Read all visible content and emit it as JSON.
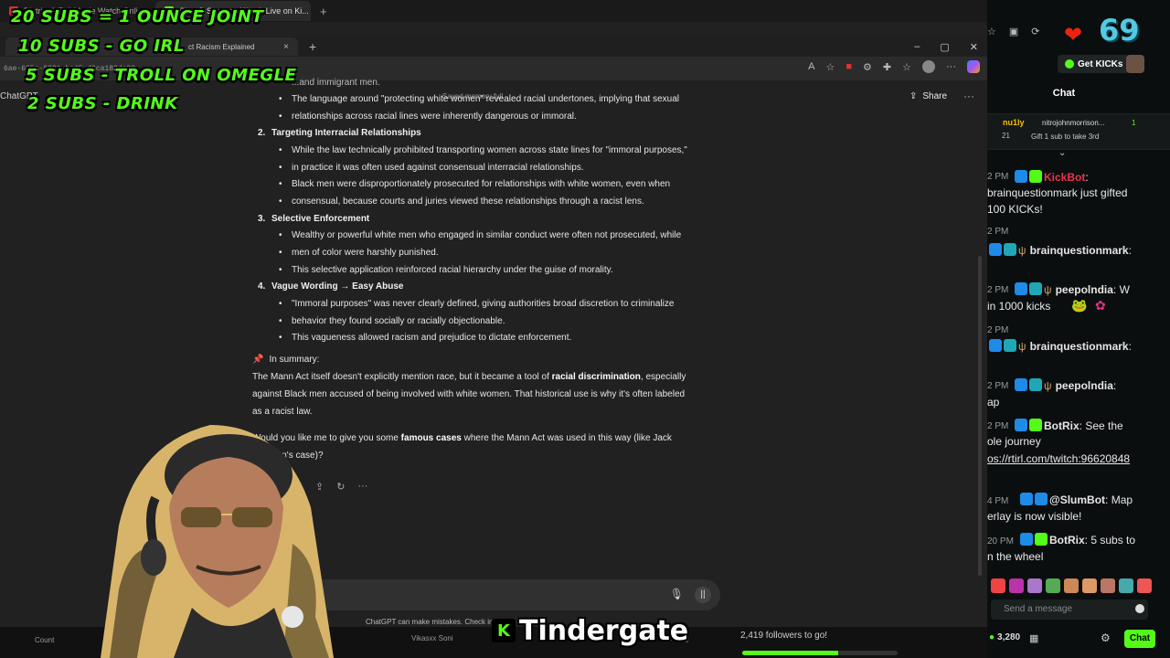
{
  "outer": {
    "tabs": [
      "District 9 Full Movie Watch Onli...",
      "SlumG Stream - Watch Live on Ki..."
    ],
    "new_tab": "+"
  },
  "inner": {
    "tab_title": "ct Racism Explained",
    "tab_close": "×",
    "new_tab": "+",
    "win_min": "–",
    "win_max": "▢",
    "win_close": "✕",
    "url": "6ae-685c-8321-bc45-d0ca182dc33"
  },
  "gpt": {
    "app_label": "ChatGPT",
    "saved_memory": "Saved memory full",
    "share": "Share",
    "more": "···",
    "lines": {
      "l0": "...and immigrant men.",
      "l1": "The language around \"protecting white women\" revealed racial undertones, implying that sexual",
      "l2": "relationships across racial lines were inherently dangerous or immoral.",
      "h2": "Targeting Interracial Relationships",
      "l3": "While the law technically prohibited transporting women across state lines for \"immoral purposes,\"",
      "l4": "in practice it was often used against consensual interracial relationships.",
      "l5": "Black men were disproportionately prosecuted for relationships with white women, even when",
      "l6": "consensual, because courts and juries viewed these relationships through a racist lens.",
      "h3": "Selective Enforcement",
      "l7": "Wealthy or powerful white men who engaged in similar conduct were often not prosecuted, while",
      "l8": "men of color were harshly punished.",
      "l9": "This selective application reinforced racial hierarchy under the guise of morality.",
      "h4": "Vague Wording → Easy Abuse",
      "l10": "\"Immoral purposes\" was never clearly defined, giving authorities broad discretion to criminalize",
      "l11": "behavior they found socially or racially objectionable.",
      "l12": "This vagueness allowed racism and prejudice to dictate enforcement.",
      "summary": "In summary:",
      "s1a": "The Mann Act itself doesn't explicitly mention race, but it became a tool of ",
      "s1b": "racial discrimination",
      "s1c": ", especially",
      "s2": "against Black men accused of being involved with white women. That historical use is why it's often labeled",
      "s3": "as a racist law.",
      "q1a": "Would you like me to give you some ",
      "q1b": "famous cases",
      "q1c": " where the Mann Act was used in this way (like Jack",
      "q2": "Johnson's case)?"
    },
    "nums": {
      "n2": "2.",
      "n3": "3.",
      "n4": "4."
    },
    "disclaimer": "ChatGPT can make mistakes. Check im"
  },
  "overlay": {
    "goal1": "20 SUBS = 1 OUNCE JOINT",
    "goal2": "10 SUBS - GO IRL",
    "goal3": "5 SUBS - TROLL ON OMEGLE",
    "goal4": "2 SUBS - DRINK",
    "brand": "Tindergate",
    "brand_logo": "K"
  },
  "taskbar": {
    "followers": "2,419 followers to go!",
    "follow_progress": 0.62,
    "left": "Count",
    "mid": "Vikasxx Soni",
    "right": "Islumg"
  },
  "chat": {
    "big_number": "69",
    "get_kicks": "Get KICKs",
    "title": "Chat",
    "pinned": {
      "user": "nu1ly",
      "user2": "nitrojohnmorrison...",
      "count": "1",
      "sub_num": "21",
      "gift": "Gift 1 sub to take 3rd"
    },
    "messages": [
      {
        "time": "2 PM",
        "user": "KickBot",
        "text": ":"
      },
      {
        "time": "",
        "user": "",
        "text": "brainquestionmark just gifted"
      },
      {
        "time": "",
        "user": "",
        "text": "100 KICKs!"
      },
      {
        "time": "2 PM",
        "user": "",
        "text": ""
      },
      {
        "time": "",
        "user": "brainquestionmark",
        "text": ":"
      },
      {
        "time": "2 PM",
        "user": "peepolndia",
        "text": ": W"
      },
      {
        "time": "",
        "user": "",
        "text": "in 1000 kicks"
      },
      {
        "time": "2 PM",
        "user": "",
        "text": ""
      },
      {
        "time": "",
        "user": "brainquestionmark",
        "text": ":"
      },
      {
        "time": "2 PM",
        "user": "peepolndia",
        "text": ":"
      },
      {
        "time": "",
        "user": "",
        "text": "ap"
      },
      {
        "time": "2 PM",
        "user": "BotRix",
        "text": ": See the"
      },
      {
        "time": "",
        "user": "",
        "text": "ole journey"
      },
      {
        "time": "",
        "user": "",
        "text": "os://rtirl.com/twitch:96620848"
      },
      {
        "time": "4 PM",
        "user": "@SlumBot",
        "text": ": Map"
      },
      {
        "time": "",
        "user": "",
        "text": "erlay is now visible!"
      },
      {
        "time": "20 PM",
        "user": "BotRix",
        "text": ": 5 subs to"
      },
      {
        "time": "",
        "user": "",
        "text": "n the wheel"
      }
    ],
    "input_placeholder": "Send a message",
    "kicks_count": "3,280",
    "send": "Chat",
    "colors": {
      "green": "#53fc18",
      "kickbot": "#e8344e",
      "user": "#e6e6e6"
    }
  }
}
